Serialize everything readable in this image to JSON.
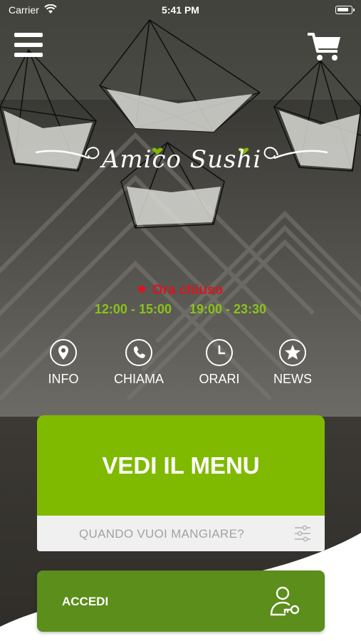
{
  "status_bar": {
    "carrier": "Carrier",
    "time": "5:41 PM"
  },
  "header": {
    "menu_icon": "hamburger-icon",
    "cart_icon": "shopping-cart-icon"
  },
  "brand": {
    "name": "Amico Sushi",
    "accent": "#7fba00"
  },
  "restaurant_status": {
    "text": "Ora chiuso",
    "color": "#d9161f",
    "hours": [
      "12:00 - 15:00",
      "19:00 - 23:30"
    ],
    "hours_color": "#8bc21a"
  },
  "actions": [
    {
      "label": "INFO",
      "icon": "location-pin-icon"
    },
    {
      "label": "CHIAMA",
      "icon": "phone-icon"
    },
    {
      "label": "ORARI",
      "icon": "clock-icon"
    },
    {
      "label": "NEWS",
      "icon": "star-badge-icon"
    }
  ],
  "menu_card": {
    "label": "VEDI IL MENU",
    "color": "#7fba00"
  },
  "when": {
    "placeholder": "QUANDO VUOI MANGIARE?",
    "icon": "sliders-icon"
  },
  "login": {
    "label": "ACCEDI",
    "icon": "user-key-icon",
    "color": "#5b8e1a"
  }
}
